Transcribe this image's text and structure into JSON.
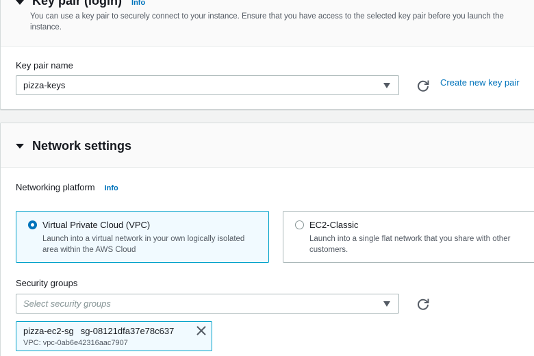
{
  "key_pair": {
    "title": "Key pair (login)",
    "info_label": "Info",
    "description": "You can use a key pair to securely connect to your instance. Ensure that you have access to the selected key pair before you launch the instance.",
    "field_label": "Key pair name",
    "selected_value": "pizza-keys",
    "create_link": "Create new key pair"
  },
  "network_settings": {
    "title": "Network settings",
    "platform_label": "Networking platform",
    "info_label": "Info",
    "options": [
      {
        "title": "Virtual Private Cloud (VPC)",
        "description": "Launch into a virtual network in your own logically isolated area within the AWS Cloud",
        "selected": true
      },
      {
        "title": "EC2-Classic",
        "description": "Launch into a single flat network that you share with other customers.",
        "selected": false
      }
    ],
    "security_groups_label": "Security groups",
    "security_groups_placeholder": "Select security groups",
    "selected_groups": [
      {
        "name": "pizza-ec2-sg",
        "id": "sg-08121dfa37e78c637",
        "vpc": "VPC: vpc-0ab6e42316aac7907"
      }
    ]
  },
  "colors": {
    "link": "#0073bb",
    "selected_border": "#00a1c9",
    "selected_bg": "#f1faff"
  },
  "icons": {
    "refresh": "refresh-icon",
    "dropdown": "caret-down-icon",
    "remove": "close-icon",
    "expand": "caret-down-icon"
  }
}
